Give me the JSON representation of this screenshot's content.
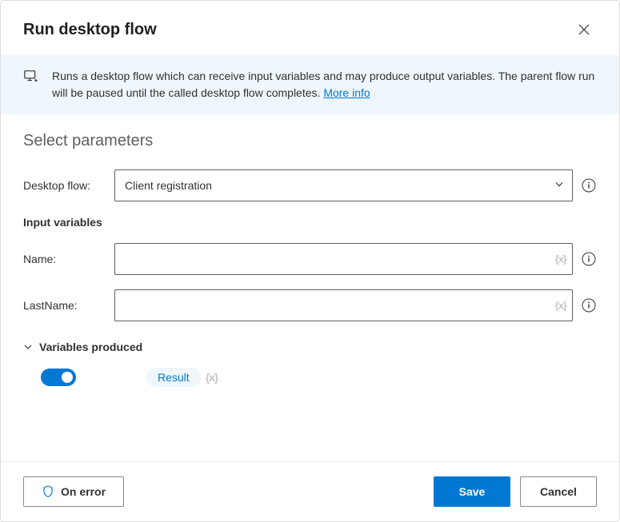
{
  "header": {
    "title": "Run desktop flow"
  },
  "banner": {
    "text": "Runs a desktop flow which can receive input variables and may produce output variables. The parent flow run will be paused until the called desktop flow completes. ",
    "link_label": "More info"
  },
  "section": {
    "title": "Select parameters",
    "desktop_flow_label": "Desktop flow:",
    "desktop_flow_value": "Client registration",
    "input_vars_heading": "Input variables",
    "name_label": "Name:",
    "name_value": "",
    "lastname_label": "LastName:",
    "lastname_value": "",
    "vars_produced_heading": "Variables produced",
    "result_chip": "Result",
    "var_token": "{x}"
  },
  "footer": {
    "on_error": "On error",
    "save": "Save",
    "cancel": "Cancel"
  }
}
